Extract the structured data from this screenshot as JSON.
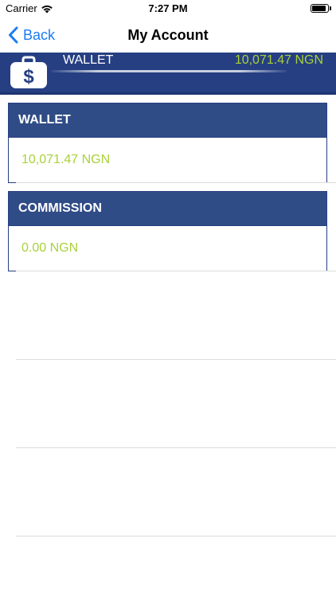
{
  "status_bar": {
    "carrier": "Carrier",
    "time": "7:27 PM",
    "battery_level": 0.9
  },
  "nav": {
    "back_label": "Back",
    "title": "My Account"
  },
  "header": {
    "label": "WALLET",
    "amount": "10,071.47 NGN"
  },
  "cards": [
    {
      "title": "WALLET",
      "value": "10,071.47 NGN"
    },
    {
      "title": "COMMISSION",
      "value": "0.00 NGN"
    }
  ],
  "colors": {
    "brand_blue": "#263f83",
    "card_header_blue": "#304c86",
    "amount_green": "#a9d13a",
    "link_blue": "#1a7cf5"
  },
  "icons": {
    "back": "chevron-left-icon",
    "wallet": "wallet-dollar-icon",
    "wifi": "wifi-icon",
    "battery": "battery-icon"
  }
}
